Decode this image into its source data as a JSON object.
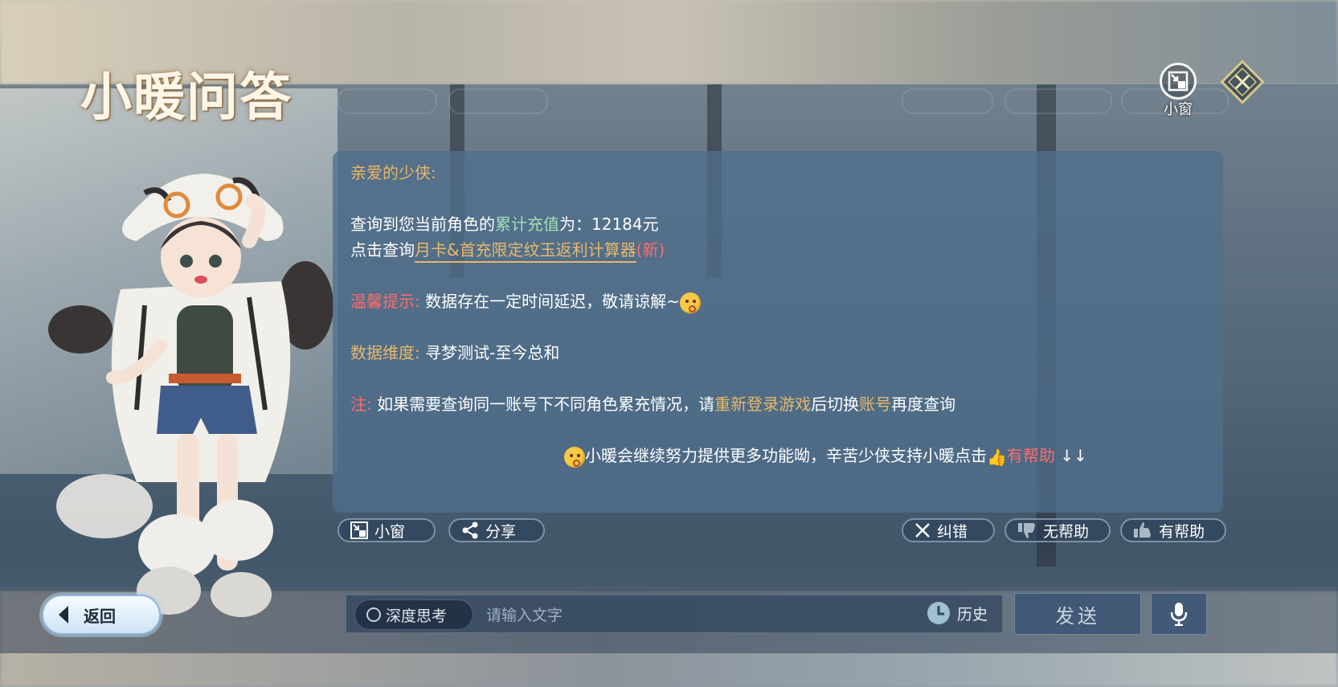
{
  "title": "小暖问答",
  "topbar": {
    "mini_window_label": "小窗"
  },
  "panel": {
    "greeting": "亲爱的少侠:",
    "line1_prefix": "查询到您当前角色的",
    "line1_highlight": "累计充值",
    "line1_suffix": "为：12184元",
    "line2_prefix": "点击查询",
    "line2_link": "月卡&首充限定纹玉返利计算器",
    "line2_new": "(新)",
    "tip_label": "温馨提示:",
    "tip_text": "数据存在一定时间延迟，敬请谅解~",
    "dimension_label": "数据维度:",
    "dimension_text": "寻梦测试-至今总和",
    "note_label": "注:",
    "note_text_1": "如果需要查询同一账号下不同角色累充情况，请",
    "note_highlight_1": "重新登录游戏",
    "note_text_2": "后切换",
    "note_highlight_2": "账号",
    "note_text_3": "再度查询",
    "footer_text": "小暖会继续努力提供更多功能呦，辛苦少侠支持小暖点击",
    "footer_helpful": "有帮助",
    "footer_arrows": "↓↓"
  },
  "actions": {
    "mini_window": "小窗",
    "share": "分享",
    "correct": "纠错",
    "not_helpful": "无帮助",
    "helpful": "有帮助"
  },
  "bottom": {
    "back": "返回",
    "deep_think": "深度思考",
    "input_placeholder": "请输入文字",
    "history": "历史",
    "send": "发送"
  },
  "colors": {
    "gold": "#e8b86a",
    "green": "#9fe0b4",
    "red": "#ff6b6b",
    "panel": "#506e8c"
  }
}
